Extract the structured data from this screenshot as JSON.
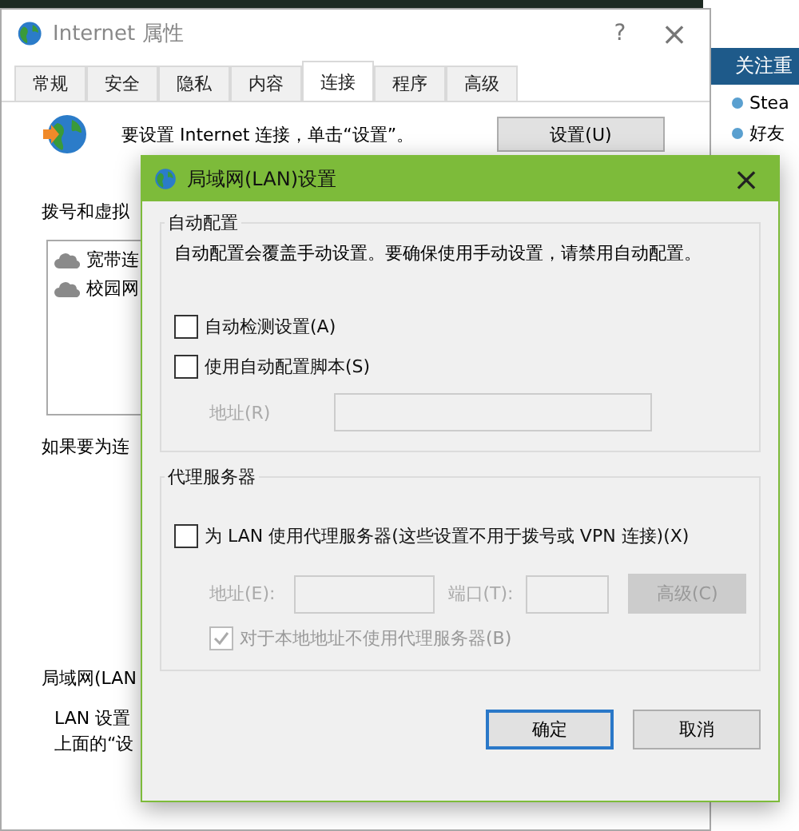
{
  "background_page": {
    "header": "关注重",
    "items": [
      "Stea",
      "好友"
    ]
  },
  "window": {
    "title": "Internet 属性",
    "help": "?",
    "close": "×"
  },
  "tabs": [
    {
      "label": "常规",
      "selected": false
    },
    {
      "label": "安全",
      "selected": false
    },
    {
      "label": "隐私",
      "selected": false
    },
    {
      "label": "内容",
      "selected": false
    },
    {
      "label": "连接",
      "selected": true
    },
    {
      "label": "程序",
      "selected": false
    },
    {
      "label": "高级",
      "selected": false
    }
  ],
  "connection": {
    "setup_text": "要设置 Internet 连接，单击“设置”。",
    "setup_button": "设置(U)"
  },
  "dialup": {
    "heading": "拨号和虚拟",
    "items": [
      "宽带连",
      "校园网"
    ]
  },
  "proxy_hint": "如果要为连",
  "lan": {
    "heading": "局域网(LAN",
    "lines": [
      "LAN 设置",
      "上面的“设"
    ]
  },
  "dialog": {
    "title": "局域网(LAN)设置",
    "close": "×",
    "auto_config": {
      "legend": "自动配置",
      "description": "自动配置会覆盖手动设置。要确保使用手动设置，请禁用自动配置。",
      "options": [
        {
          "label": "自动检测设置(A)",
          "checked": false
        },
        {
          "label": "使用自动配置脚本(S)",
          "checked": false
        }
      ],
      "address": {
        "label": "地址(R)",
        "disabled": true
      }
    },
    "proxy": {
      "legend": "代理服务器",
      "use_proxy": {
        "label": "为 LAN 使用代理服务器(这些设置不用于拨号或 VPN 连接)(X)",
        "checked": false
      },
      "address_label": "地址(E):",
      "port_label": "端口(T):",
      "advanced_button": "高级(C)",
      "disabled": true,
      "bypass_local": {
        "label": "对于本地地址不使用代理服务器(B)",
        "checked": true
      }
    },
    "buttons": [
      {
        "label": "确定",
        "default": true
      },
      {
        "label": "取消",
        "default": false
      }
    ]
  }
}
